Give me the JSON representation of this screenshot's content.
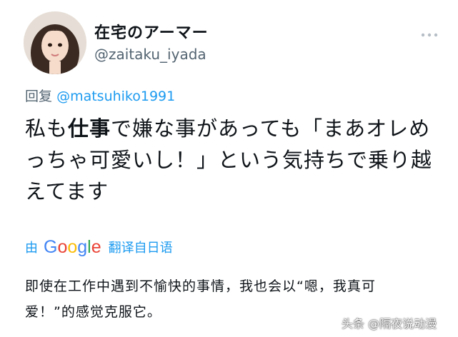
{
  "author": {
    "display_name": "在宅のアーマー",
    "handle": "@zaitaku_iyada"
  },
  "reply": {
    "prefix": "回复",
    "mention": "@matsuhiko1991"
  },
  "tweet": {
    "text_part1": "私も",
    "text_emphasis": "仕事",
    "text_part2": "で嫌な事があっても「まあオレめっちゃ可愛いし！」という気持ちで乗り越えてます"
  },
  "translation": {
    "by_label": "由",
    "google_logo": "Google",
    "label": "翻译自日语",
    "text": "即使在工作中遇到不愉快的事情，我也会以“嗯，我真可爱！”的感觉克服它。"
  },
  "watermark": "头条 @隔夜说动漫",
  "icons": {
    "avatar": "avatar-photo",
    "more": "more-icon"
  },
  "colors": {
    "link": "#1d9bf0",
    "secondary_text": "#536471",
    "primary_text": "#0f1419"
  }
}
